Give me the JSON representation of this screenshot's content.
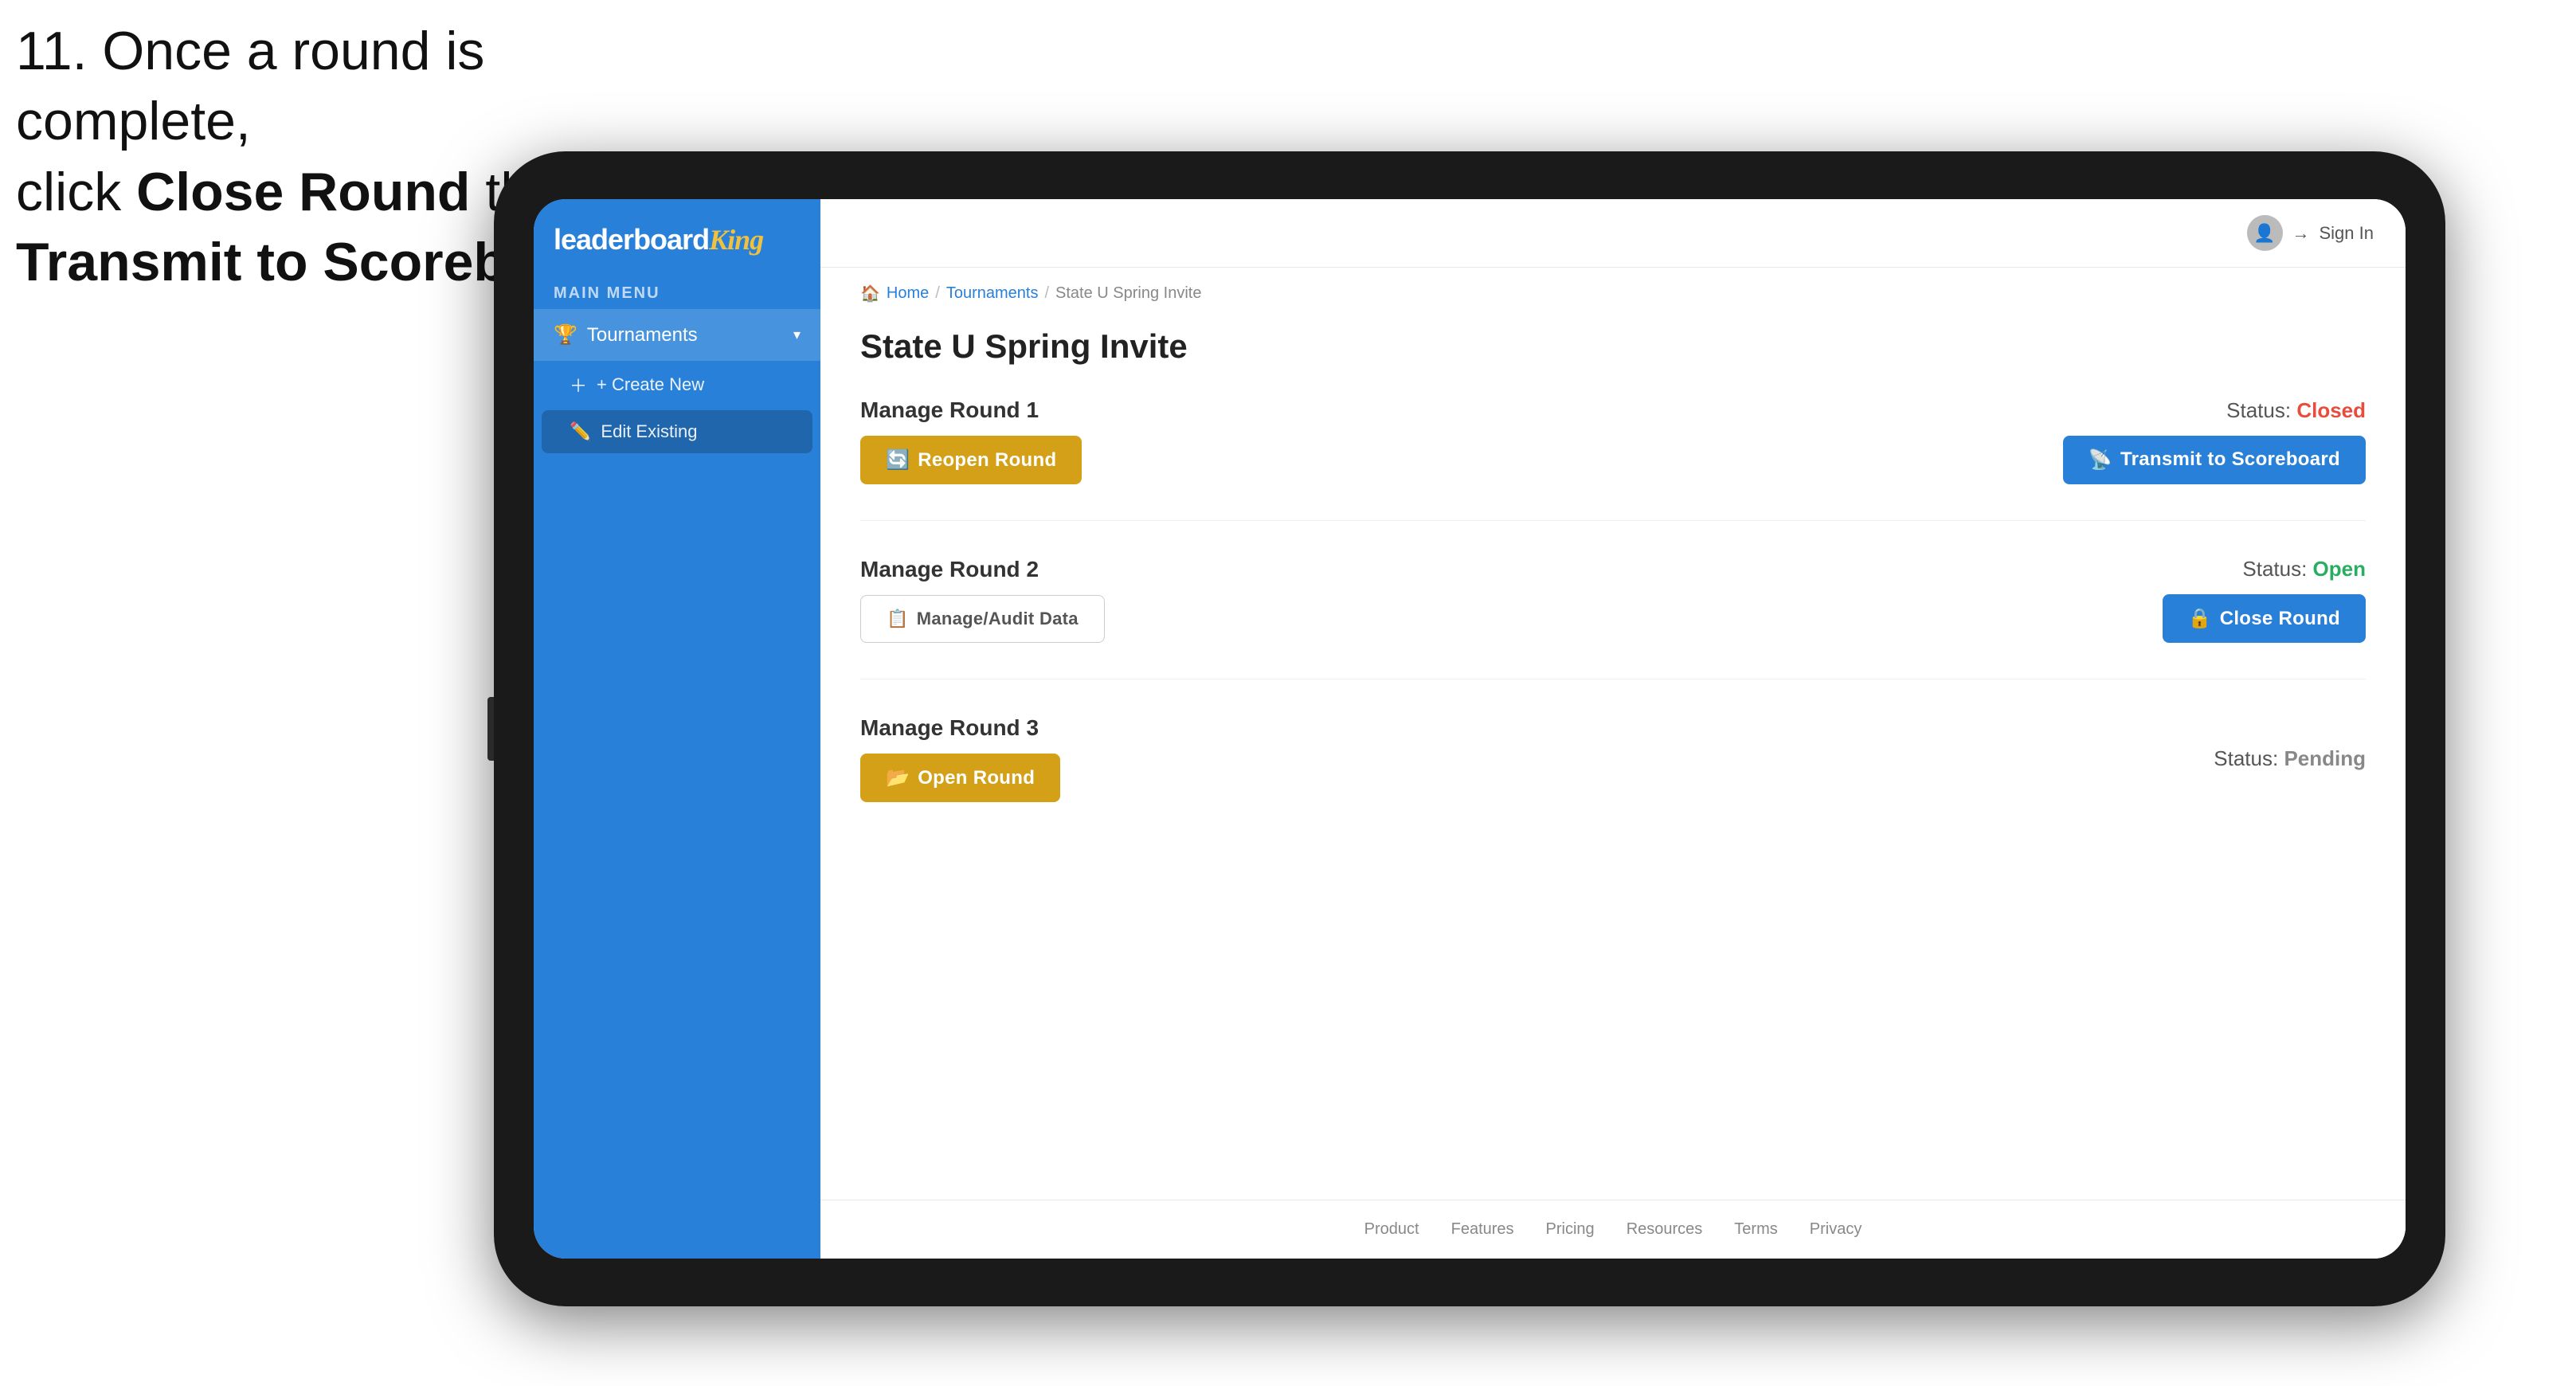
{
  "instruction": {
    "line1": "11. Once a round is complete,",
    "line2_prefix": "click ",
    "line2_bold": "Close Round",
    "line2_suffix": " then click",
    "line3_bold": "Transmit to Scoreboard."
  },
  "app": {
    "logo": {
      "leaderboard": "leaderboard",
      "king": "King"
    },
    "topbar": {
      "sign_in": "Sign In"
    },
    "breadcrumb": {
      "home": "Home",
      "tournaments": "Tournaments",
      "current": "State U Spring Invite"
    },
    "sidebar": {
      "main_menu_label": "MAIN MENU",
      "tournaments_label": "Tournaments",
      "create_new_label": "+ Create New",
      "edit_existing_label": "Edit Existing"
    },
    "page": {
      "title": "State U Spring Invite",
      "rounds": [
        {
          "id": 1,
          "manage_label": "Manage Round 1",
          "status_label": "Status:",
          "status_value": "Closed",
          "status_class": "status-closed",
          "primary_btn": "Reopen Round",
          "primary_btn_type": "gold",
          "secondary_btn": "Transmit to Scoreboard",
          "secondary_btn_type": "blue",
          "show_audit": false
        },
        {
          "id": 2,
          "manage_label": "Manage Round 2",
          "status_label": "Status:",
          "status_value": "Open",
          "status_class": "status-open",
          "primary_btn": "Manage/Audit Data",
          "primary_btn_type": "outline",
          "secondary_btn": "Close Round",
          "secondary_btn_type": "blue",
          "show_audit": true
        },
        {
          "id": 3,
          "manage_label": "Manage Round 3",
          "status_label": "Status:",
          "status_value": "Pending",
          "status_class": "status-pending",
          "primary_btn": "Open Round",
          "primary_btn_type": "gold",
          "secondary_btn": null
        }
      ]
    },
    "footer": {
      "links": [
        "Product",
        "Features",
        "Pricing",
        "Resources",
        "Terms",
        "Privacy"
      ]
    }
  }
}
